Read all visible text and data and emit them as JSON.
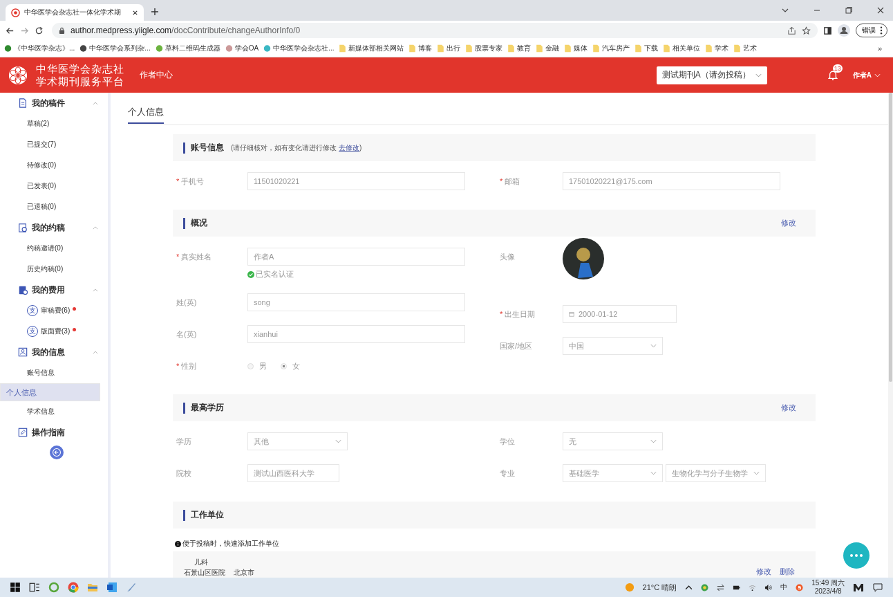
{
  "browser": {
    "tab_title": "中华医学会杂志社一体化学术期",
    "url_host": "author.medpress.yiigle.com",
    "url_path": "/docContribute/changeAuthorInfo/0",
    "profile_label": "错误"
  },
  "bookmarks": [
    {
      "label": "《中华医学杂志》...",
      "kind": "site"
    },
    {
      "label": "中华医学会系列杂...",
      "kind": "site"
    },
    {
      "label": "草料二维码生成器",
      "kind": "site"
    },
    {
      "label": "学会OA",
      "kind": "site"
    },
    {
      "label": "中华医学会杂志社...",
      "kind": "site"
    },
    {
      "label": "新媒体部相关网站",
      "kind": "folder"
    },
    {
      "label": "博客",
      "kind": "folder"
    },
    {
      "label": "出行",
      "kind": "folder"
    },
    {
      "label": "股票专家",
      "kind": "folder"
    },
    {
      "label": "教育",
      "kind": "folder"
    },
    {
      "label": "金融",
      "kind": "folder"
    },
    {
      "label": "媒体",
      "kind": "folder"
    },
    {
      "label": "汽车房产",
      "kind": "folder"
    },
    {
      "label": "下载",
      "kind": "folder"
    },
    {
      "label": "相关单位",
      "kind": "folder"
    },
    {
      "label": "学术",
      "kind": "folder"
    },
    {
      "label": "艺术",
      "kind": "folder"
    }
  ],
  "bookmarks_more": "»",
  "header": {
    "title_lines": [
      "中华医学会杂志社",
      "学术期刊服务平台"
    ],
    "nav": "作者中心",
    "journal": "测试期刊A（请勿投稿）",
    "notifications": "13",
    "user": "作者A"
  },
  "sidebar": {
    "groups": [
      {
        "title": "我的稿件",
        "expanded": true,
        "items": [
          {
            "label": "草稿(2)",
            "selected": false,
            "alert": false
          },
          {
            "label": "已提交(7)",
            "selected": false,
            "alert": false
          },
          {
            "label": "待修改(0)",
            "selected": false,
            "alert": false
          },
          {
            "label": "已发表(0)",
            "selected": false,
            "alert": false
          },
          {
            "label": "已退稿(0)",
            "selected": false,
            "alert": false
          }
        ]
      },
      {
        "title": "我的约稿",
        "expanded": true,
        "items": [
          {
            "label": "约稿邀请(0)",
            "selected": false,
            "alert": false
          },
          {
            "label": "历史约稿(0)",
            "selected": false,
            "alert": false
          }
        ]
      },
      {
        "title": "我的费用",
        "expanded": true,
        "items": [
          {
            "label": "审稿费(6)",
            "icon_char": "支",
            "selected": false,
            "alert": true
          },
          {
            "label": "版面费(3)",
            "icon_char": "支",
            "selected": false,
            "alert": true
          }
        ]
      },
      {
        "title": "我的信息",
        "expanded": true,
        "items": [
          {
            "label": "账号信息",
            "selected": false,
            "alert": false
          },
          {
            "label": "个人信息",
            "selected": true,
            "alert": false
          },
          {
            "label": "学术信息",
            "selected": false,
            "alert": false
          }
        ]
      },
      {
        "title": "操作指南"
      }
    ]
  },
  "page_tab": {
    "label": "个人信息",
    "selected": true
  },
  "sections": [
    {
      "title": "账号信息",
      "hint": {
        "text": "(请仔细核对，如有变化请进行修改 ",
        "link": "去修改",
        "end": ")"
      },
      "left": [
        {
          "kind": "text",
          "label": "手机号",
          "required_mark": "*",
          "value": "11501020221"
        }
      ],
      "right": [
        {
          "kind": "text",
          "label": "邮箱",
          "required_mark": "*",
          "value": "17501020221@175.com"
        }
      ]
    },
    {
      "title": "概况",
      "action": "修改",
      "left": [
        {
          "kind": "text",
          "label": "真实姓名",
          "required_mark": "*",
          "value": "作者A",
          "verified": "已实名认证"
        },
        {
          "kind": "text",
          "label": "姓(英)",
          "value": "song"
        },
        {
          "kind": "text",
          "label": "名(英)",
          "value": "xianhui"
        },
        {
          "kind": "radio",
          "label": "性别",
          "required_mark": "*",
          "options": [
            {
              "label": "男",
              "selected": false
            },
            {
              "label": "女",
              "selected": true
            }
          ]
        }
      ],
      "right": [
        {
          "kind": "avatar",
          "label": "头像"
        },
        {
          "kind": "date",
          "label": "出生日期",
          "required_mark": "*",
          "value": "2000-01-12"
        },
        {
          "kind": "select",
          "label": "国家/地区",
          "values": [
            "中国"
          ]
        }
      ]
    },
    {
      "title": "最高学历",
      "action": "修改",
      "left": [
        {
          "kind": "select",
          "label": "学历",
          "values": [
            "其他"
          ]
        },
        {
          "kind": "shorttext",
          "label": "院校",
          "value": "测试山西医科大学"
        }
      ],
      "right": [
        {
          "kind": "select",
          "label": "学位",
          "values": [
            "无"
          ]
        },
        {
          "kind": "select",
          "label": "专业",
          "values": [
            "基础医学",
            "生物化学与分子生物学"
          ]
        }
      ]
    },
    {
      "title": "工作单位",
      "note": "便于投稿时，快速添加工作单位",
      "units": [
        {
          "department": "儿科",
          "organization": "石景山区医院",
          "city": "北京市",
          "actions": [
            "修改",
            "删除"
          ]
        }
      ]
    }
  ],
  "taskbar": {
    "weather": "21°C 晴朗",
    "input_method": "中",
    "time": "15:49 周六",
    "date": "2023/4/8"
  }
}
